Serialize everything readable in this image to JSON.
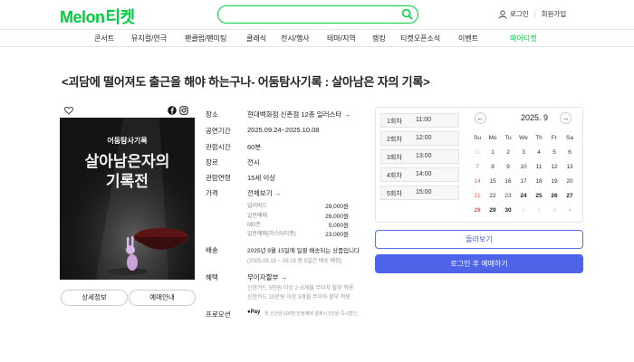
{
  "header": {
    "logo": "Melon",
    "logo_sub": "티켓",
    "search_placeholder": "",
    "login": "로그인",
    "signup": "회원가입"
  },
  "nav": {
    "items": [
      "콘서트",
      "뮤지컬/연극",
      "팬클럽/팬미팅",
      "클래식",
      "전시/행사",
      "테마/지역",
      "랭킹",
      "티켓오픈소식",
      "이벤트"
    ],
    "special": "마이티켓"
  },
  "title": "<괴담에 떨어져도 출근을 해야 하는구나- 어둠탐사기록 : 살아남은 자의 기록>",
  "poster": {
    "top_line": "어둠탐사기록",
    "big_line_1": "살아남은자의",
    "big_line_2": "기록전",
    "detail_button": "상세정보",
    "booking_button": "예매안내"
  },
  "info": {
    "venue_label": "장소",
    "venue_value": "현대백화점 신촌점 12층 일러스타 →",
    "period_label": "공연기간",
    "period_value": "2025.09.24~2025.10.08",
    "duration_label": "관람시간",
    "duration_value": "60분",
    "genre_label": "장르",
    "genre_value": "전시",
    "age_label": "관람연령",
    "age_value": "15세 이상",
    "price_label": "가격",
    "price_view_all": "전체보기 →",
    "prices": [
      {
        "name": "얼리버드",
        "value": "28,000원"
      },
      {
        "name": "일반예매",
        "value": "26,000원"
      },
      {
        "name": "MD존",
        "value": "5,000원"
      },
      {
        "name": "일반예매(하스터티켓)",
        "value": "23,000원"
      }
    ],
    "delivery_label": "배송",
    "delivery_value": "2025년 9월 15일에 일괄 배송되는 상품입니다",
    "delivery_sub": "(2025.09.15 ~ 09.19 중 5일간 배송 예정)",
    "benefit_label": "혜택",
    "benefit_value": "무이자할부 →",
    "benefit_lines": [
      "신한카드 5만원 이상 2~5개월 무이자 할부 적용",
      "신한카드 10만원 이상 3개월 무이자 할부 적용"
    ],
    "promo_label": "프로모션",
    "promo_badge": "Pay",
    "promo_value": "및 신한금 500명 한정혜택 결제시 5천원 즉시할인"
  },
  "rounds": [
    {
      "round": "1회차",
      "time": "11:00"
    },
    {
      "round": "2회차",
      "time": "12:00"
    },
    {
      "round": "3회차",
      "time": "13:00"
    },
    {
      "round": "4회차",
      "time": "14:00"
    },
    {
      "round": "5회차",
      "time": "15:00"
    }
  ],
  "calendar": {
    "title": "2025. 9",
    "prev": "←",
    "next": "→",
    "weekdays": [
      "Su",
      "Mo",
      "Tu",
      "We",
      "Th",
      "Fr",
      "Sa"
    ],
    "weeks": [
      [
        "31",
        "1",
        "2",
        "3",
        "4",
        "5",
        "6"
      ],
      [
        "7",
        "8",
        "9",
        "10",
        "11",
        "12",
        "13"
      ],
      [
        "14",
        "15",
        "16",
        "17",
        "18",
        "19",
        "20"
      ],
      [
        "21",
        "22",
        "23",
        "24",
        "25",
        "26",
        "27"
      ],
      [
        "28",
        "29",
        "30",
        "1",
        "2",
        "3",
        "4"
      ]
    ]
  },
  "buttons": {
    "look_around": "둘러보기",
    "login_book": "로그인 후 예매하기"
  },
  "colors": {
    "brand": "#00cd3c",
    "primary": "#4d63e8",
    "sunday": "#e05a5a"
  }
}
